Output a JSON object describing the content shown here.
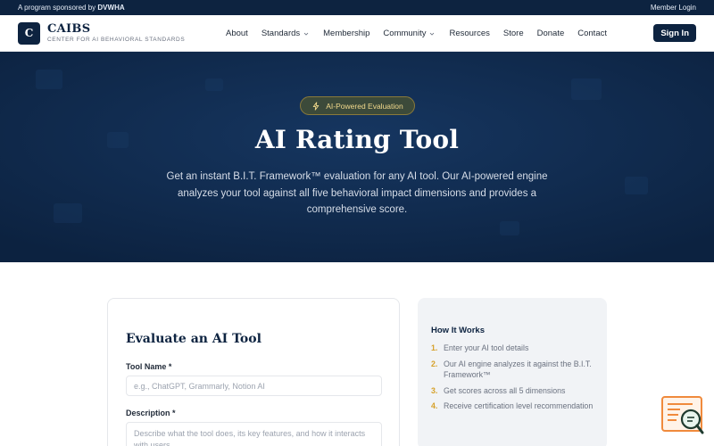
{
  "topbar": {
    "sponsor_prefix": "A program sponsored by",
    "sponsor_name": "DVWHA",
    "member_login": "Member Login"
  },
  "brand": {
    "logo_letter": "C",
    "title": "CAIBS",
    "subtitle": "CENTER FOR AI BEHAVIORAL STANDARDS"
  },
  "nav": {
    "items": [
      {
        "label": "About",
        "has_dropdown": false
      },
      {
        "label": "Standards",
        "has_dropdown": true
      },
      {
        "label": "Membership",
        "has_dropdown": false
      },
      {
        "label": "Community",
        "has_dropdown": true
      },
      {
        "label": "Resources",
        "has_dropdown": false
      },
      {
        "label": "Store",
        "has_dropdown": false
      },
      {
        "label": "Donate",
        "has_dropdown": false
      },
      {
        "label": "Contact",
        "has_dropdown": false
      }
    ],
    "signin_label": "Sign In"
  },
  "hero": {
    "badge": "AI-Powered Evaluation",
    "badge_icon": "lightning-icon",
    "title": "AI Rating Tool",
    "description": "Get an instant B.I.T. Framework™ evaluation for any AI tool. Our AI-powered engine analyzes your tool against all five behavioral impact dimensions and provides a comprehensive score."
  },
  "form": {
    "title": "Evaluate an AI Tool",
    "tool_name_label": "Tool Name *",
    "tool_name_placeholder": "e.g., ChatGPT, Grammarly, Notion AI",
    "tool_name_value": "",
    "description_label": "Description *",
    "description_placeholder": "Describe what the tool does, its key features, and how it interacts with users...",
    "description_value": ""
  },
  "how_it_works": {
    "title": "How It Works",
    "steps": [
      {
        "num": "1.",
        "text": "Enter your AI tool details"
      },
      {
        "num": "2.",
        "text": "Our AI engine analyzes it against the B.I.T. Framework™"
      },
      {
        "num": "3.",
        "text": "Get scores across all 5 dimensions"
      },
      {
        "num": "4.",
        "text": "Receive certification level recommendation"
      }
    ]
  },
  "chat_widget": {
    "icon": "chat-search-icon"
  },
  "colors": {
    "navy": "#0d2340",
    "hero_bg": "#0f2a4d",
    "accent_gold": "#d6a12a",
    "widget_orange": "#f08a3c"
  }
}
